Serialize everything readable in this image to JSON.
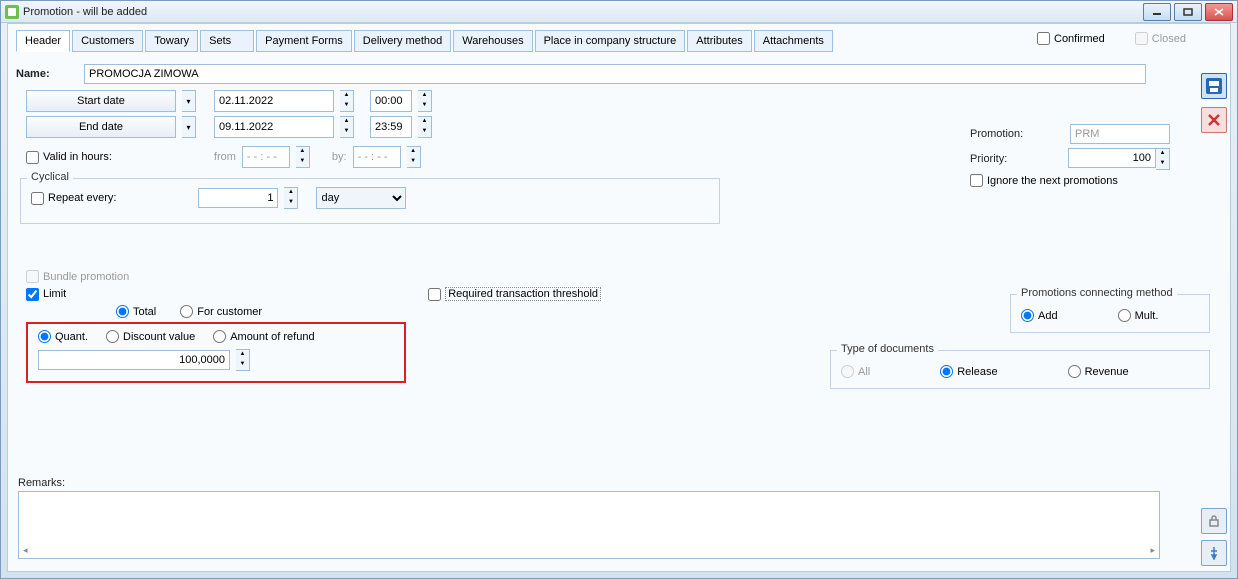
{
  "window": {
    "title": "Promotion - will be added"
  },
  "top_checks": {
    "confirmed": "Confirmed",
    "closed": "Closed"
  },
  "tabs": [
    "Header",
    "Customers",
    "Towary",
    "Sets",
    "Payment Forms",
    "Delivery method",
    "Warehouses",
    "Place in company structure",
    "Attributes",
    "Attachments"
  ],
  "name": {
    "label": "Name:",
    "value": "PROMOCJA ZIMOWA"
  },
  "dates": {
    "start_btn": "Start date",
    "end_btn": "End date",
    "start_date": "02.11.2022",
    "start_time": "00:00",
    "end_date": "09.11.2022",
    "end_time": "23:59"
  },
  "valid_hours": {
    "label": "Valid in hours:",
    "from": "from",
    "by": "by:",
    "placeholder": "- - : - -"
  },
  "cyclical": {
    "legend": "Cyclical",
    "repeat": "Repeat every:",
    "value": "1",
    "unit": "day"
  },
  "right": {
    "promotion_lbl": "Promotion:",
    "promotion_val": "PRM",
    "priority_lbl": "Priority:",
    "priority_val": "100",
    "ignore": "Ignore the next promotions"
  },
  "bundle": "Bundle promotion",
  "limit": "Limit",
  "limit_scope": {
    "total": "Total",
    "for_customer": "For customer"
  },
  "req_threshold": "Required transaction threshold",
  "limit_type": {
    "quant": "Quant.",
    "discount": "Discount value",
    "refund": "Amount of refund",
    "value": "100,0000"
  },
  "conn_method": {
    "legend": "Promotions connecting method",
    "add": "Add",
    "mult": "Mult."
  },
  "doc_type": {
    "legend": "Type of documents",
    "all": "All",
    "release": "Release",
    "revenue": "Revenue"
  },
  "remarks": "Remarks:"
}
